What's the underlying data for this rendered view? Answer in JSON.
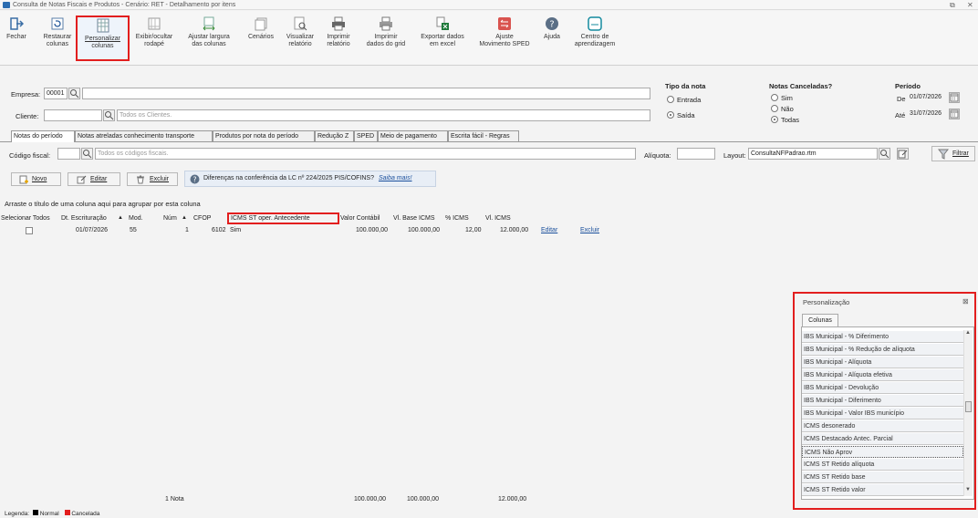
{
  "window": {
    "title": "Consulta de Notas Fiscais e Produtos - Cenário: RET - Detalhamento por itens"
  },
  "toolbar": [
    {
      "label1": "Fechar",
      "label2": "",
      "icon": "exit-icon"
    },
    {
      "label1": "Restaurar",
      "label2": "colunas",
      "icon": "restore-icon"
    },
    {
      "label1": "Personalizar",
      "label2": "colunas",
      "icon": "columns-icon"
    },
    {
      "label1": "Exibir/ocultar",
      "label2": "rodapé",
      "icon": "footer-icon"
    },
    {
      "label1": "Ajustar largura",
      "label2": "das colunas",
      "icon": "width-icon"
    },
    {
      "label1": "Cenários",
      "label2": "",
      "icon": "scenarios-icon"
    },
    {
      "label1": "Visualizar",
      "label2": "relatório",
      "icon": "preview-icon"
    },
    {
      "label1": "Imprimir",
      "label2": "relatório",
      "icon": "print-icon"
    },
    {
      "label1": "Imprimir",
      "label2": "dados do grid",
      "icon": "print-grid-icon"
    },
    {
      "label1": "Exportar dados",
      "label2": "em excel",
      "icon": "excel-icon"
    },
    {
      "label1": "Ajuste",
      "label2": "Movimento SPED",
      "icon": "sped-icon"
    },
    {
      "label1": "Ajuda",
      "label2": "",
      "icon": "help-icon"
    },
    {
      "label1": "Centro de",
      "label2": "aprendizagem",
      "icon": "learning-icon"
    }
  ],
  "filters": {
    "empresa_label": "Empresa:",
    "empresa_value": "00001",
    "cliente_label": "Cliente:",
    "cliente_placeholder": "Todos os Clientes.",
    "tipo_nota_label": "Tipo da nota",
    "tipo_entrada": "Entrada",
    "tipo_saida": "Saída",
    "canceladas_label": "Notas Canceladas?",
    "canc_sim": "Sim",
    "canc_nao": "Não",
    "canc_todas": "Todas",
    "periodo_label": "Período",
    "de_label": "De",
    "de_value": "01/07/2026",
    "ate_label": "Até",
    "ate_value": "31/07/2026"
  },
  "tabs": [
    "Notas do período",
    "Notas atreladas conhecimento transporte",
    "Produtos por nota do período",
    "Redução Z",
    "SPED",
    "Meio de pagamento",
    "Escrita fácil - Regras"
  ],
  "codfiscal": {
    "label": "Código fiscal:",
    "placeholder": "Todos os códigos fiscais.",
    "aliquota_label": "Alíquota:",
    "layout_label": "Layout:",
    "layout_value": "ConsultaNFPadrao.rtm",
    "filtrar": "Filtrar"
  },
  "actions": {
    "novo": "Novo",
    "editar": "Editar",
    "excluir": "Excluir",
    "info_text": "Diferenças na conferência da LC nº 224/2025 PIS/COFINS?",
    "info_link": "Saiba mais!"
  },
  "grid": {
    "group_hint": "Arraste o título de uma coluna aqui para agrupar por esta coluna",
    "headers": [
      "Selecionar Todos",
      "Dt. Escrituração",
      "Mod.",
      "Núm",
      "CFOP",
      "ICMS ST oper. Antecedente",
      "Valor Contábil",
      "Vl. Base ICMS",
      "% ICMS",
      "Vl. ICMS"
    ],
    "row": {
      "date": "01/07/2026",
      "mod": "55",
      "num": "1",
      "cfop": "6102",
      "icms_st": "Sim",
      "valor_contabil": "100.000,00",
      "vl_base": "100.000,00",
      "pct_icms": "12,00",
      "vl_icms": "12.000,00",
      "editar": "Editar",
      "excluir": "Excluir"
    },
    "footer": {
      "count": "1 Nota",
      "valor_contabil": "100.000,00",
      "vl_base": "100.000,00",
      "vl_icms": "12.000,00"
    }
  },
  "personalizacao": {
    "title": "Personalização",
    "tab": "Colunas",
    "items": [
      "IBS Municipal - % Diferimento",
      "IBS Municipal - % Redução de alíquota",
      "IBS Municipal - Alíquota",
      "IBS Municipal - Alíquota efetiva",
      "IBS Municipal - Devolução",
      "IBS Municipal - Diferimento",
      "IBS Municipal - Valor IBS município",
      "ICMS desonerado",
      "ICMS Destacado Antec. Parcial",
      "ICMS Não Aprov",
      "ICMS ST Retido alíquota",
      "ICMS ST Retido base",
      "ICMS ST Retido valor"
    ]
  },
  "legend": {
    "label": "Legenda:",
    "normal": "Normal",
    "cancelada": "Cancelada"
  },
  "colors": {
    "highlight": "#e21e1e",
    "link": "#1a4f9c",
    "legend_normal": "#000000",
    "legend_cancelada": "#e21e1e"
  }
}
